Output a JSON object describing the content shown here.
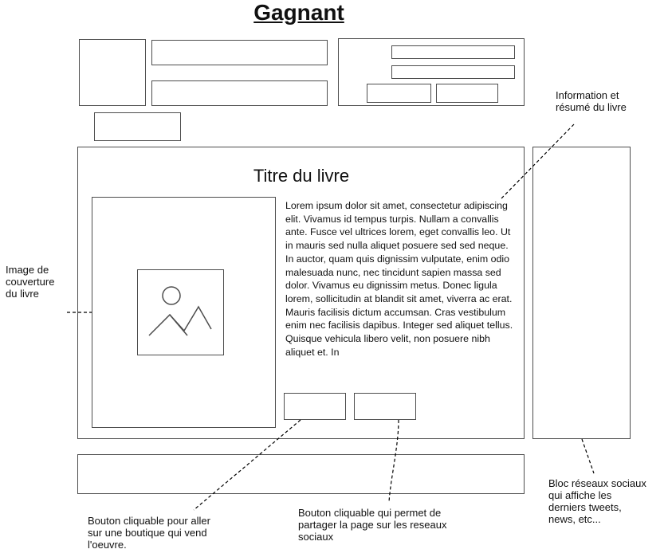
{
  "heading": "Gagnant",
  "book": {
    "title": "Titre du livre",
    "summary": "Lorem ipsum dolor sit amet, consectetur adipiscing elit. Vivamus id tempus turpis. Nullam a convallis ante. Fusce vel ultrices lorem, eget convallis leo. Ut in mauris sed nulla aliquet posuere sed sed neque. In auctor, quam quis dignissim vulputate, enim odio malesuada nunc, nec tincidunt sapien massa sed dolor. Vivamus eu dignissim metus. Donec ligula lorem, sollicitudin at blandit sit amet, viverra ac erat. Mauris facilisis dictum accumsan. Cras vestibulum enim nec facilisis dapibus. Integer sed aliquet tellus. Quisque vehicula libero velit, non posuere nibh aliquet et. In"
  },
  "icons": {
    "cover_placeholder": "image-placeholder-icon"
  },
  "annotations": {
    "summary_note": [
      "Information et",
      "résumé du livre"
    ],
    "cover_note": [
      "Image de",
      "couverture",
      "du livre"
    ],
    "shop_note": [
      "Bouton cliquable pour aller",
      "sur une boutique qui vend",
      "l'oeuvre."
    ],
    "share_note": [
      "Bouton cliquable qui permet de",
      "partager la page sur les reseaux",
      "sociaux"
    ],
    "social_note": [
      "Bloc réseaux sociaux",
      "qui affiche les",
      "derniers tweets,",
      "news, etc..."
    ]
  },
  "colors": {
    "stroke": "#4d4d4d",
    "text": "#111111"
  }
}
